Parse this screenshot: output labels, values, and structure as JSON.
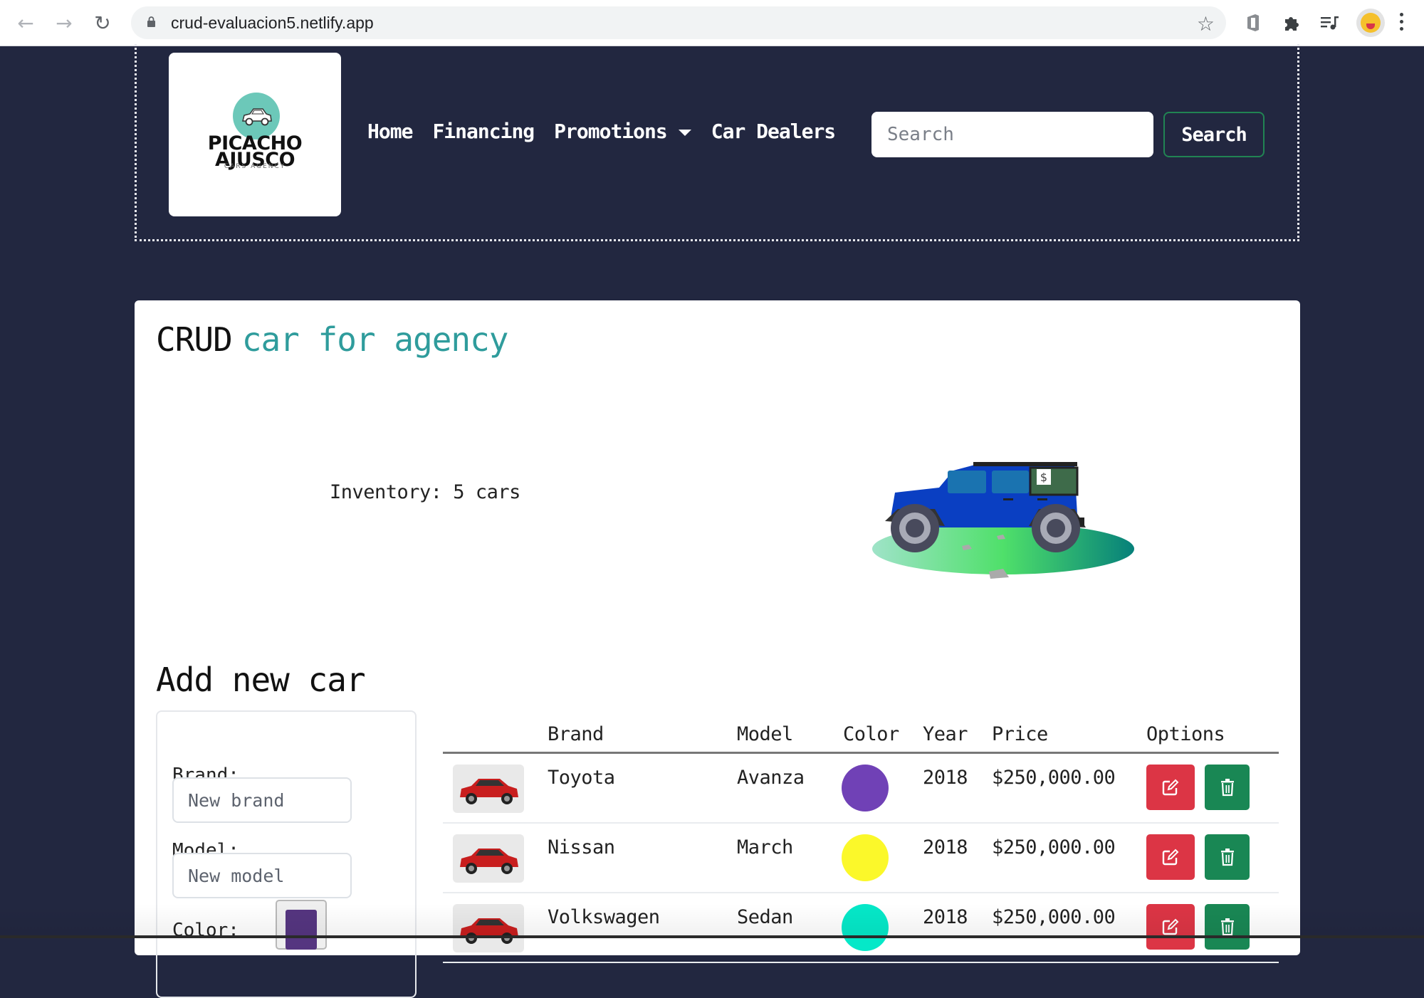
{
  "browser": {
    "url": "crud-evaluacion5.netlify.app",
    "icons": [
      "back-icon",
      "forward-icon",
      "reload-icon",
      "lock-icon",
      "bookmark-star-icon",
      "office-extension-icon",
      "extensions-puzzle-icon",
      "media-playlist-icon",
      "profile-avatar-icon",
      "menu-kebab-icon"
    ]
  },
  "header": {
    "logo": {
      "line1": "PICACHO",
      "line2": "AJUSCO",
      "tagline": "CARS AGENCY"
    },
    "nav": [
      {
        "label": "Home"
      },
      {
        "label": "Financing"
      },
      {
        "label": "Promotions",
        "has_dropdown": true
      },
      {
        "label": "Car Dealers"
      }
    ],
    "search": {
      "placeholder": "Search",
      "value": "",
      "button_label": "Search"
    }
  },
  "main": {
    "title_prefix": "CRUD",
    "title_accent": "car for agency",
    "inventory_text": "Inventory: 5 cars",
    "add_title": "Add new car",
    "form": {
      "brand_label": "Brand:",
      "brand_placeholder": "New brand",
      "model_label": "Model:",
      "model_placeholder": "New model",
      "color_label": "Color:",
      "color_value": "#553580"
    },
    "table": {
      "headers": [
        "",
        "Brand",
        "Model",
        "Color",
        "Year",
        "Price",
        "Options"
      ],
      "rows": [
        {
          "brand": "Toyota",
          "model": "Avanza",
          "color": "#7041b6",
          "year": "2018",
          "price": "$250,000.00"
        },
        {
          "brand": "Nissan",
          "model": "March",
          "color": "#fbf82a",
          "year": "2018",
          "price": "$250,000.00"
        },
        {
          "brand": "Volkswagen",
          "model": "Sedan",
          "color": "#05e8c8",
          "year": "2018",
          "price": "$250,000.00"
        }
      ]
    }
  },
  "colors": {
    "background": "#222740",
    "accent_teal": "#2f9c9c",
    "edit_button": "#dc3545",
    "delete_button": "#198754",
    "search_border": "#218453"
  }
}
